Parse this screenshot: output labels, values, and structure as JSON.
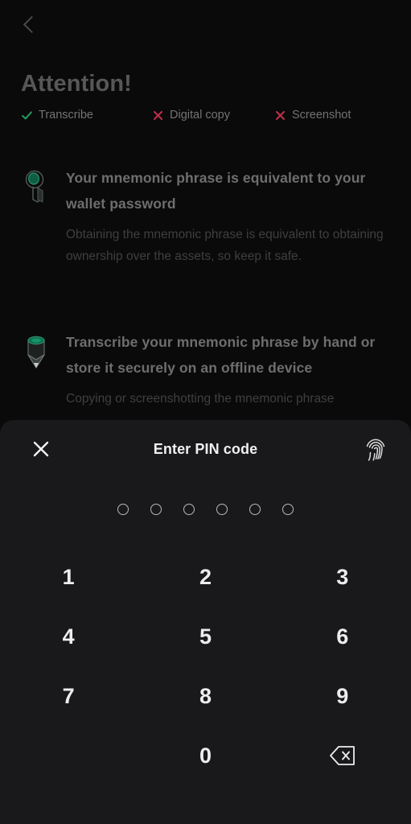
{
  "page": {
    "back_icon": "chevron-left-icon",
    "title": "Attention!",
    "status": [
      {
        "icon": "check-icon",
        "label": "Transcribe",
        "state": "allowed",
        "color": "#1e9e63"
      },
      {
        "icon": "cross-icon",
        "label": "Digital copy",
        "state": "forbidden",
        "color": "#bf3049"
      },
      {
        "icon": "cross-icon",
        "label": "Screenshot",
        "state": "forbidden",
        "color": "#bf3049"
      }
    ],
    "blocks": [
      {
        "icon": "key-3d-icon",
        "heading": "Your mnemonic phrase is equivalent to your wallet password",
        "body": "Obtaining the mnemonic phrase is equivalent to obtaining ownership over the assets, so keep it safe."
      },
      {
        "icon": "pencil-3d-icon",
        "heading": "Transcribe your mnemonic phrase by hand or store it securely on an offline device",
        "body": "Copying or screenshotting the mnemonic phrase"
      }
    ]
  },
  "sheet": {
    "close_icon": "close-icon",
    "title": "Enter PIN code",
    "biometric_icon": "fingerprint-icon",
    "pin_length": 6,
    "pin_filled": 0,
    "keys": [
      {
        "label": "1",
        "name": "key-1"
      },
      {
        "label": "2",
        "name": "key-2"
      },
      {
        "label": "3",
        "name": "key-3"
      },
      {
        "label": "4",
        "name": "key-4"
      },
      {
        "label": "5",
        "name": "key-5"
      },
      {
        "label": "6",
        "name": "key-6"
      },
      {
        "label": "7",
        "name": "key-7"
      },
      {
        "label": "8",
        "name": "key-8"
      },
      {
        "label": "9",
        "name": "key-9"
      },
      {
        "label": "",
        "name": "key-blank"
      },
      {
        "label": "0",
        "name": "key-0"
      },
      {
        "label": "",
        "name": "key-backspace",
        "icon": "backspace-icon"
      }
    ]
  },
  "theme": {
    "page_bg": "#0a0a0a",
    "sheet_bg": "#19191b",
    "accent_green": "#1e9e63",
    "accent_red": "#bf3049",
    "icon_teal": "#17archive"
  }
}
